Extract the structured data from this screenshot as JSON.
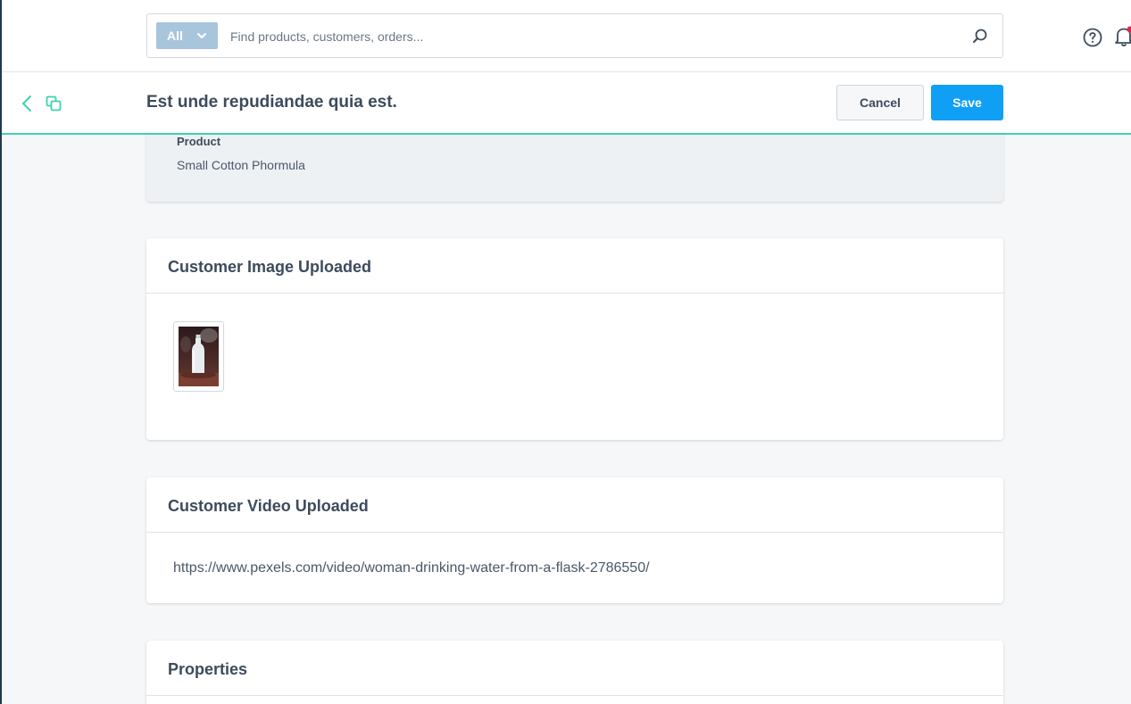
{
  "search": {
    "scope_label": "All",
    "placeholder": "Find products, customers, orders..."
  },
  "icons": {
    "help": "help-circle-icon",
    "notifications": "bell-icon",
    "back": "chevron-left-icon",
    "duplicate": "copy-icon",
    "search": "search-icon",
    "scope_dropdown": "chevron-down-icon"
  },
  "header": {
    "title": "Est unde repudiandae quia est.",
    "cancel_label": "Cancel",
    "save_label": "Save"
  },
  "product": {
    "label": "Product",
    "value": "Small Cotton Phormula"
  },
  "image_section": {
    "title": "Customer Image Uploaded"
  },
  "video_section": {
    "title": "Customer Video Uploaded",
    "url": "https://www.pexels.com/video/woman-drinking-water-from-a-flask-2786550/"
  },
  "properties_section": {
    "title": "Properties"
  },
  "colors": {
    "accent_teal": "#3fd1b0",
    "primary_blue": "#0fa0f5",
    "scope_button": "#a8c5dc",
    "notification_dot": "#e0244c"
  }
}
